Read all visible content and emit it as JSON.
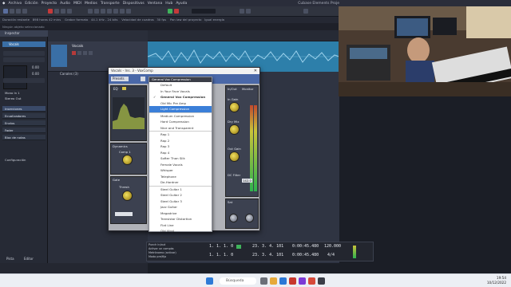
{
  "menubar": {
    "items": [
      "Archivo",
      "Edición",
      "Proyecto",
      "Audio",
      "MIDI",
      "Medios",
      "Transporte",
      "Dispositivos",
      "Ventana",
      "Hub",
      "Ayuda"
    ],
    "window_title": "Cubase Elements Proje"
  },
  "infoline": {
    "fields": [
      "Duración restante",
      "898 horas 42 mins",
      "Grabar formato",
      "44.1 kHz - 24 bits",
      "Velocidad de cuadros",
      "30 fps",
      "Pan law del proyecto",
      "Igual energía"
    ]
  },
  "statusline": {
    "text": "Ningún objeto seleccionado"
  },
  "inspector": {
    "tab": "Inspector",
    "track_name": "Vocals",
    "value_a": "0.00",
    "value_b": "0.00",
    "routing_in": "Mono In 1",
    "routing_out": "Stereo Out",
    "sections": [
      "Inserciones",
      "Ecualizadores",
      "Envíos",
      "Fader",
      "Bloc de notas"
    ],
    "configuration": "Configuración",
    "bottom_tabs": [
      "Pista",
      "Editor"
    ]
  },
  "tracklist": {
    "track_name": "Vocals",
    "lower_label": "Canales (3)"
  },
  "plugin": {
    "window_title": "Vocals - Ins. 3 - VoxComp",
    "presets_label": "Presets",
    "eq_label": "EQ",
    "dynamics_label": "Dynamics",
    "comp_label": "Comp 1",
    "gate_label": "Gate",
    "threshold_label": "Thresh",
    "inout_label": "In/Out",
    "monitor_label": "Monitor",
    "in_gain_label": "In Gain",
    "dry_mix_label": "Dry Mix",
    "out_gain_label": "Out Gain",
    "dc_filter_label": "DC Filter",
    "freq_value": "142.0",
    "sat_label": "Sat",
    "header_preset": "General Vox Compression"
  },
  "dropdown": {
    "header": "General Vox Compression",
    "items": [
      {
        "label": "Default",
        "state": ""
      },
      {
        "label": "In Your Face Vocals",
        "state": ""
      },
      {
        "label": "General Vox Compression",
        "state": "checked"
      },
      {
        "label": "Old Mic Pre Amp",
        "state": ""
      },
      {
        "label": "Light Compression",
        "state": "hl"
      },
      {
        "label": "Medium Compression",
        "state": "sep"
      },
      {
        "label": "Hard Compression",
        "state": ""
      },
      {
        "label": "Nice and Transparent",
        "state": ""
      },
      {
        "label": "Rap 1",
        "state": "sep"
      },
      {
        "label": "Rap 2",
        "state": ""
      },
      {
        "label": "Rap 3",
        "state": ""
      },
      {
        "label": "Rap 4",
        "state": ""
      },
      {
        "label": "Softer Than Silk",
        "state": ""
      },
      {
        "label": "Female Vocals",
        "state": ""
      },
      {
        "label": "Whisper",
        "state": ""
      },
      {
        "label": "Telephone",
        "state": ""
      },
      {
        "label": "De-Hardner",
        "state": ""
      },
      {
        "label": "Steel Guitar 1",
        "state": "sep"
      },
      {
        "label": "Steel Guitar 2",
        "state": ""
      },
      {
        "label": "Steel Guitar 3",
        "state": ""
      },
      {
        "label": "Jazz Guitar",
        "state": ""
      },
      {
        "label": "Megadrive",
        "state": ""
      },
      {
        "label": "Transistor Distortion",
        "state": ""
      },
      {
        "label": "Flat Line",
        "state": ""
      },
      {
        "label": "Old Vinyl",
        "state": ""
      },
      {
        "label": "More Body To Voice",
        "state": ""
      },
      {
        "label": "Extra Snappy Drums",
        "state": ""
      }
    ]
  },
  "transport": {
    "position": "1. 1. 1. 0",
    "position2": "1. 1. 1. 0",
    "bars": "23. 3. 4. 101",
    "time": "0:00:45.480",
    "bars2": "23. 3. 4. 101",
    "time2": "0:00:45.480",
    "tempo": "120.000",
    "signature": "4/4",
    "options": [
      "Punch in/out",
      "Activar un compás",
      "Metrónomo (activar)",
      "Modo pre/fijo"
    ]
  },
  "taskbar": {
    "search_placeholder": "Búsqueda",
    "time": "19:54",
    "date": "10/12/2022"
  },
  "colors": {
    "accent": "#3b7fd8",
    "audio_event": "#2d7faa",
    "plugin_header": "#4a68a8",
    "knob": "#e0cc4a"
  }
}
